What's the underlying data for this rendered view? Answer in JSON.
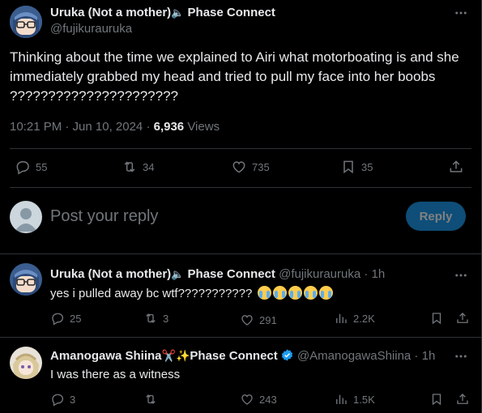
{
  "main_tweet": {
    "display_name": "Uruka (Not a mother)",
    "name_suffix": "Phase Connect",
    "handle": "@fujikurauruka",
    "text": "Thinking about the time we explained to Airi what motorboating is and she immediately grabbed my head and tried to pull my face into her boobs ??????????????????????",
    "time": "10:21 PM · Jun 10, 2024 · ",
    "views_count": "6,936",
    "views_label": " Views",
    "replies": "55",
    "reposts": "34",
    "likes": "735",
    "bookmarks": "35"
  },
  "compose": {
    "placeholder": "Post your reply",
    "reply_button": "Reply"
  },
  "replies": [
    {
      "display_name": "Uruka (Not a mother)",
      "name_suffix": "Phase Connect",
      "handle": "@fujikurauruka",
      "age": " · 1h",
      "text": "yes i pulled away bc wtf???????????",
      "emoji": [
        "loudly-crying-face",
        "loudly-crying-face",
        "loudly-crying-face",
        "loudly-crying-face",
        "loudly-crying-face"
      ],
      "replies": "25",
      "reposts": "3",
      "likes": "291",
      "views": "2.2K"
    },
    {
      "display_name": "Amanogawa Shiina",
      "name_suffix": "Phase Connect",
      "handle": "@AmanogawaShiina",
      "age": " · 1h",
      "text": "I was there as a witness",
      "replies": "3",
      "reposts": "",
      "likes": "243",
      "views": "1.5K"
    }
  ],
  "colors": {
    "background": "#000000",
    "text": "#e7e9ea",
    "muted": "#71767b",
    "accent": "#1d9bf0",
    "divider": "#2f3336"
  }
}
